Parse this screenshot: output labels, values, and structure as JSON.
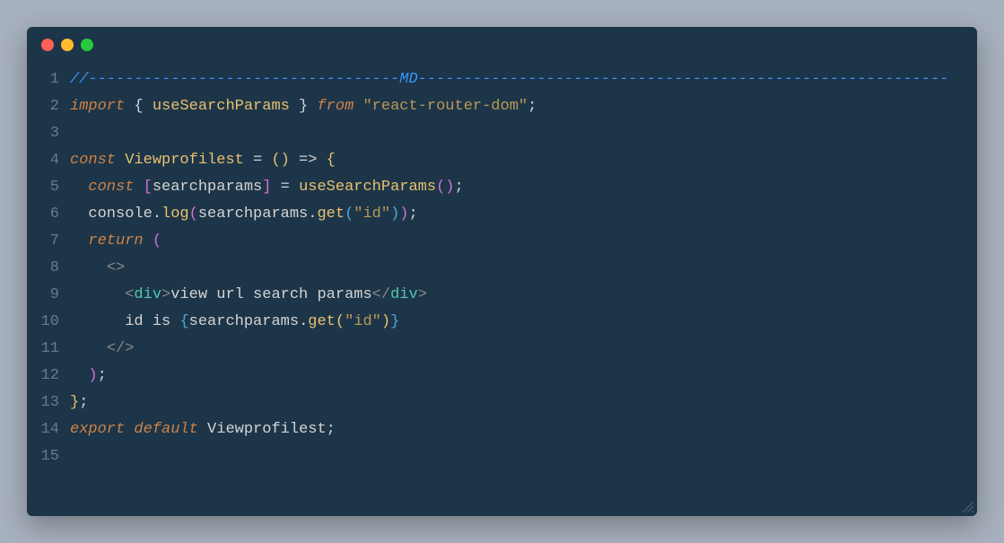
{
  "code": {
    "lines": [
      {
        "n": "1"
      },
      {
        "n": "2"
      },
      {
        "n": "3"
      },
      {
        "n": "4"
      },
      {
        "n": "5"
      },
      {
        "n": "6"
      },
      {
        "n": "7"
      },
      {
        "n": "8"
      },
      {
        "n": "9"
      },
      {
        "n": "10"
      },
      {
        "n": "11"
      },
      {
        "n": "12"
      },
      {
        "n": "13"
      },
      {
        "n": "14"
      },
      {
        "n": "15"
      }
    ],
    "line1": {
      "slashes": "//",
      "dash_left": "----------------------------------",
      "md": "MD",
      "dash_right": "----------------------------------------------------------"
    },
    "line2": {
      "import": "import",
      "lbrace": " { ",
      "usesearch": "useSearchParams",
      "rbrace": " } ",
      "from": "from",
      "sp": " ",
      "string": "\"react-router-dom\"",
      "semi": ";"
    },
    "line4": {
      "const": "const",
      "sp1": " ",
      "name": "Viewprofilest",
      "eq": " = ",
      "lp": "(",
      "rp": ")",
      "arrow": " => ",
      "lbrace": "{"
    },
    "line5": {
      "indent": "  ",
      "const": "const",
      "sp": " ",
      "lb": "[",
      "var": "searchparams",
      "rb": "]",
      "eq": " = ",
      "fn": "useSearchParams",
      "lp": "(",
      "rp": ")",
      "semi": ";"
    },
    "line6": {
      "indent": "  ",
      "console": "console",
      "dot": ".",
      "log": "log",
      "lp": "(",
      "sp": "searchparams",
      "dot2": ".",
      "get": "get",
      "lp2": "(",
      "str": "\"id\"",
      "rp2": ")",
      "rp": ")",
      "semi": ";"
    },
    "line7": {
      "indent": "  ",
      "return": "return",
      "sp": " ",
      "lp": "("
    },
    "line8": {
      "indent": "    ",
      "lt": "<",
      "gt": ">"
    },
    "line9": {
      "indent": "      ",
      "lt": "<",
      "div": "div",
      "gt": ">",
      "text": "view url search params",
      "lt2": "</",
      "div2": "div",
      "gt2": ">"
    },
    "line10": {
      "indent": "      ",
      "text1": "id is ",
      "lb": "{",
      "sp": "searchparams",
      "dot": ".",
      "get": "get",
      "lp": "(",
      "str": "\"id\"",
      "rp": ")",
      "rb": "}"
    },
    "line11": {
      "indent": "    ",
      "lt": "</",
      "gt": ">"
    },
    "line12": {
      "indent": "  ",
      "rp": ")",
      "semi": ";"
    },
    "line13": {
      "rbrace": "}",
      "semi": ";"
    },
    "line14": {
      "export": "export",
      "sp1": " ",
      "default": "default",
      "sp2": " ",
      "name": "Viewprofilest",
      "semi": ";"
    }
  }
}
